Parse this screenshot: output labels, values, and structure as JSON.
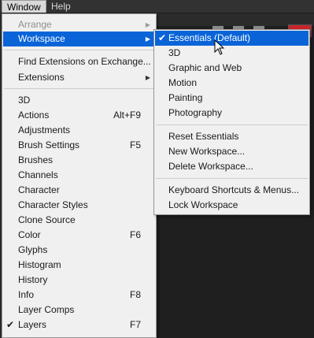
{
  "menubar": {
    "window": "Window",
    "help": "Help"
  },
  "main_menu": {
    "arrange": "Arrange",
    "workspace": "Workspace",
    "find_extensions": "Find Extensions on Exchange...",
    "extensions": "Extensions",
    "items": [
      {
        "label": "3D",
        "shortcut": ""
      },
      {
        "label": "Actions",
        "shortcut": "Alt+F9"
      },
      {
        "label": "Adjustments",
        "shortcut": ""
      },
      {
        "label": "Brush Settings",
        "shortcut": "F5"
      },
      {
        "label": "Brushes",
        "shortcut": ""
      },
      {
        "label": "Channels",
        "shortcut": ""
      },
      {
        "label": "Character",
        "shortcut": ""
      },
      {
        "label": "Character Styles",
        "shortcut": ""
      },
      {
        "label": "Clone Source",
        "shortcut": ""
      },
      {
        "label": "Color",
        "shortcut": "F6"
      },
      {
        "label": "Glyphs",
        "shortcut": ""
      },
      {
        "label": "Histogram",
        "shortcut": ""
      },
      {
        "label": "History",
        "shortcut": ""
      },
      {
        "label": "Info",
        "shortcut": "F8"
      },
      {
        "label": "Layer Comps",
        "shortcut": ""
      },
      {
        "label": "Layers",
        "shortcut": "F7"
      }
    ]
  },
  "workspace_menu": {
    "essentials": "Essentials (Default)",
    "three_d": "3D",
    "graphic_web": "Graphic and Web",
    "motion": "Motion",
    "painting": "Painting",
    "photography": "Photography",
    "reset": "Reset Essentials",
    "new_workspace": "New Workspace...",
    "delete_workspace": "Delete Workspace...",
    "keyboard_shortcuts": "Keyboard Shortcuts & Menus...",
    "lock_workspace": "Lock Workspace"
  },
  "icons": {
    "checkmark": "✔",
    "submenu_arrow": "▶"
  },
  "colors": {
    "highlight": "#0a64d8",
    "menu_bg": "#f0f0f0",
    "app_bg": "#2b2b2b"
  }
}
